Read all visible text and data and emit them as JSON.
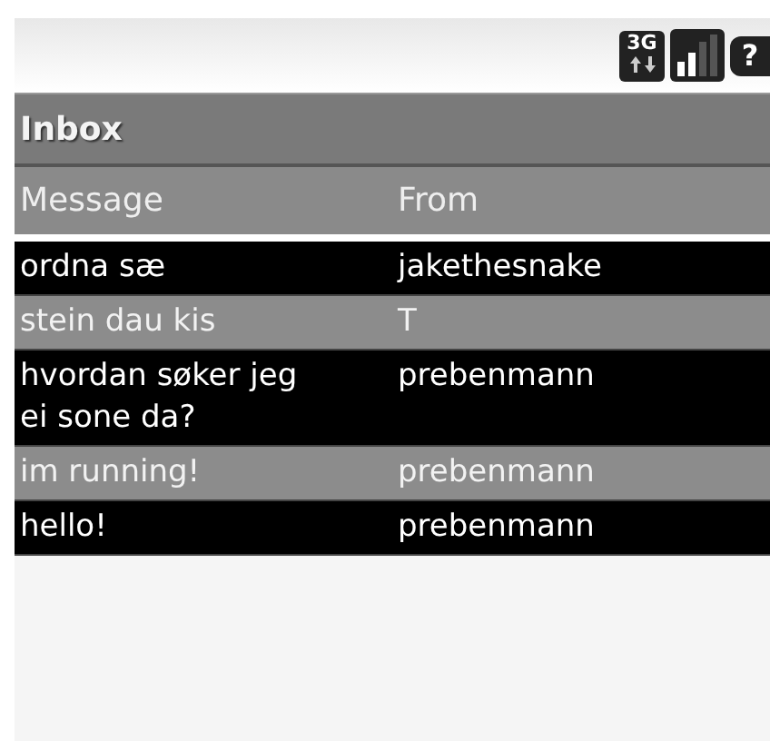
{
  "status_bar": {
    "network": "3G",
    "battery": "?"
  },
  "title": "Inbox",
  "table": {
    "columns": [
      "Message",
      "From"
    ],
    "rows": [
      {
        "message": "ordna sæ",
        "from": "jakethesnake"
      },
      {
        "message": "stein dau kis",
        "from": "T"
      },
      {
        "message": "hvordan søker jeg ei sone da?",
        "from": "prebenmann"
      },
      {
        "message": "im running!",
        "from": "prebenmann"
      },
      {
        "message": "hello!",
        "from": "prebenmann"
      }
    ]
  }
}
